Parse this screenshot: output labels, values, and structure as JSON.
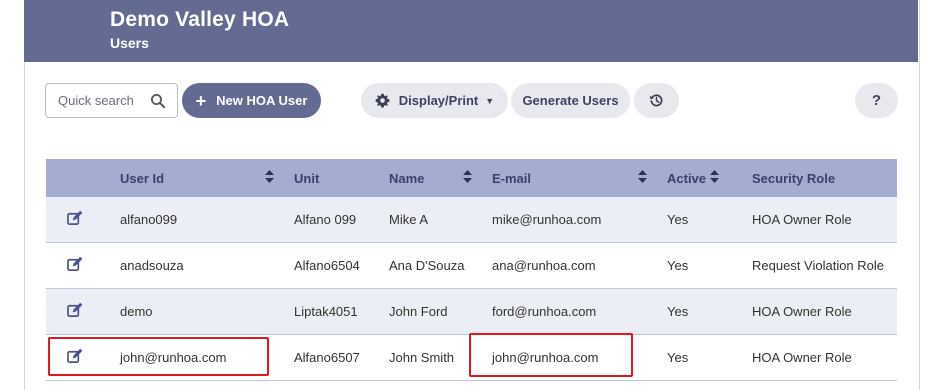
{
  "header": {
    "org_name": "Demo Valley HOA",
    "page_title": "Users"
  },
  "toolbar": {
    "search_placeholder": "Quick search",
    "new_user_label": "New HOA User",
    "display_print_label": "Display/Print",
    "generate_users_label": "Generate Users",
    "help_label": "?"
  },
  "table": {
    "columns": {
      "user_id": "User Id",
      "unit": "Unit",
      "name": "Name",
      "email": "E-mail",
      "active": "Active",
      "role": "Security Role"
    },
    "rows": [
      {
        "user_id": "alfano099",
        "unit": "Alfano 099",
        "name": "Mike A",
        "email": "mike@runhoa.com",
        "active": "Yes",
        "role": "HOA Owner Role"
      },
      {
        "user_id": "anadsouza",
        "unit": "Alfano6504",
        "name": "Ana D'Souza",
        "email": "ana@runhoa.com",
        "active": "Yes",
        "role": "Request Violation Role"
      },
      {
        "user_id": "demo",
        "unit": "Liptak4051",
        "name": "John Ford",
        "email": "ford@runhoa.com",
        "active": "Yes",
        "role": "HOA Owner Role"
      },
      {
        "user_id": "john@runhoa.com",
        "unit": "Alfano6507",
        "name": "John Smith",
        "email": "john@runhoa.com",
        "active": "Yes",
        "role": "HOA Owner Role"
      }
    ]
  },
  "colors": {
    "header_bg": "#646b92",
    "table_header_bg": "#a4accf",
    "alt_row_bg": "#eceef5",
    "highlight": "#e0191f"
  }
}
